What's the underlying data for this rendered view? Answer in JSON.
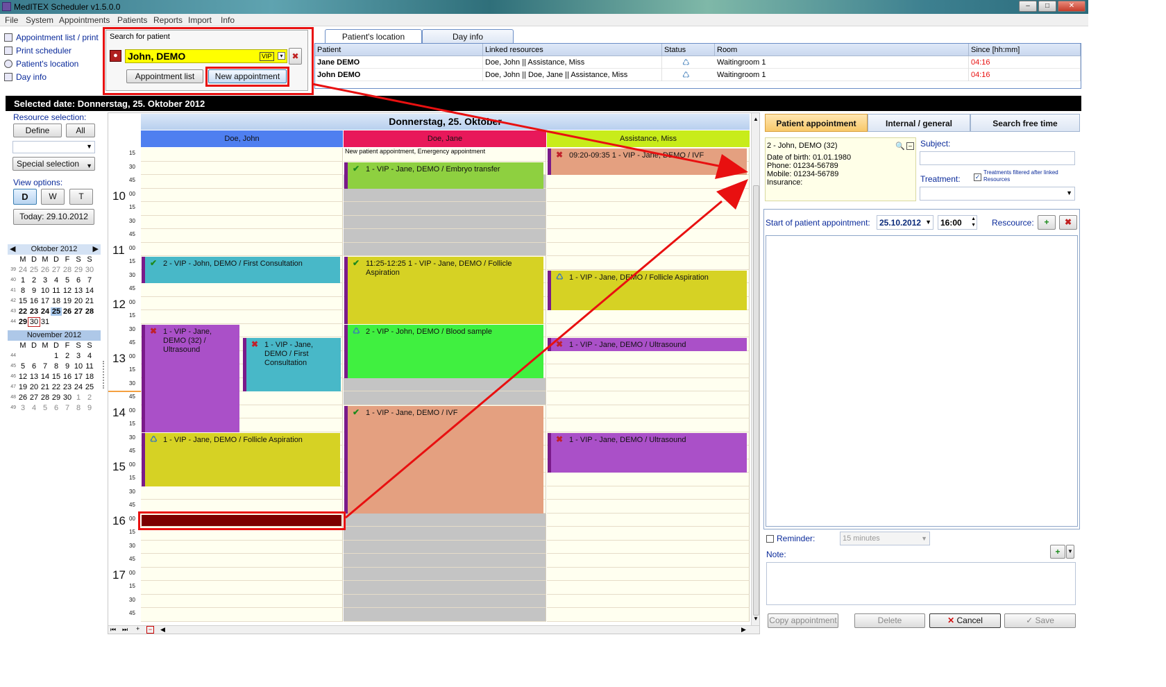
{
  "window": {
    "title": "MedITEX  Scheduler v1.5.0.0"
  },
  "menu": [
    "File",
    "System",
    "Appointments",
    "Patients",
    "Reports",
    "Import",
    "Info"
  ],
  "left_links": [
    "Appointment list / print",
    "Print scheduler",
    "Patient's location",
    "Day info"
  ],
  "search": {
    "label": "Search for patient",
    "patient_name": "John, DEMO",
    "vip_badge": "VIP",
    "appointment_list_btn": "Appointment list",
    "new_appointment_btn": "New appointment"
  },
  "location": {
    "tabs": [
      "Patient's location",
      "Day info"
    ],
    "columns": [
      "Patient",
      "Linked resources",
      "Status",
      "Room",
      "Since [hh:mm]"
    ],
    "rows": [
      {
        "patient": "Jane DEMO",
        "resources": "Doe, John || Assistance, Miss",
        "room": "Waitingroom 1",
        "since": "04:16"
      },
      {
        "patient": "John DEMO",
        "resources": "Doe, John || Doe, Jane || Assistance, Miss",
        "room": "Waitingroom 1",
        "since": "04:16"
      }
    ]
  },
  "selected_date_bar": "Selected date: Donnerstag, 25. Oktober 2012",
  "left_panel": {
    "resource_selection": "Resource selection:",
    "define_btn": "Define",
    "all_btn": "All",
    "special_selection": "Special selection",
    "view_options": "View options:",
    "view_d": "D",
    "view_w": "W",
    "view_t": "T",
    "today_btn": "Today: 29.10.2012"
  },
  "calendar": {
    "october": {
      "title": "Oktober 2012",
      "weekdays": [
        "M",
        "D",
        "M",
        "D",
        "F",
        "S",
        "S"
      ],
      "rows": [
        {
          "wk": "39",
          "days": [
            "24",
            "25",
            "26",
            "27",
            "28",
            "29",
            "30"
          ]
        },
        {
          "wk": "40",
          "days": [
            "1",
            "2",
            "3",
            "4",
            "5",
            "6",
            "7"
          ]
        },
        {
          "wk": "41",
          "days": [
            "8",
            "9",
            "10",
            "11",
            "12",
            "13",
            "14"
          ]
        },
        {
          "wk": "42",
          "days": [
            "15",
            "16",
            "17",
            "18",
            "19",
            "20",
            "21"
          ]
        },
        {
          "wk": "43",
          "days": [
            "22",
            "23",
            "24",
            "25",
            "26",
            "27",
            "28"
          ]
        },
        {
          "wk": "44",
          "days": [
            "29",
            "30",
            "31",
            "",
            "",
            "",
            ""
          ]
        }
      ]
    },
    "november": {
      "title": "November 2012",
      "weekdays": [
        "M",
        "D",
        "M",
        "D",
        "F",
        "S",
        "S"
      ],
      "rows": [
        {
          "wk": "44",
          "days": [
            "",
            "",
            "",
            "1",
            "2",
            "3",
            "4"
          ]
        },
        {
          "wk": "45",
          "days": [
            "5",
            "6",
            "7",
            "8",
            "9",
            "10",
            "11"
          ]
        },
        {
          "wk": "46",
          "days": [
            "12",
            "13",
            "14",
            "15",
            "16",
            "17",
            "18"
          ]
        },
        {
          "wk": "47",
          "days": [
            "19",
            "20",
            "21",
            "22",
            "23",
            "24",
            "25"
          ]
        },
        {
          "wk": "48",
          "days": [
            "26",
            "27",
            "28",
            "29",
            "30",
            "1",
            "2"
          ]
        },
        {
          "wk": "49",
          "days": [
            "3",
            "4",
            "5",
            "6",
            "7",
            "8",
            "9"
          ]
        }
      ]
    }
  },
  "scheduler": {
    "day_title": "Donnerstag, 25. Oktober",
    "resources": [
      {
        "name": "Doe, John",
        "color": "#4f7ff0"
      },
      {
        "name": "Doe, Jane",
        "color": "#e8185a"
      },
      {
        "name": "Assistance, Miss",
        "color": "#c8ec1a"
      }
    ],
    "hour_labels": [
      "10",
      "11",
      "12",
      "13",
      "14",
      "15",
      "16",
      "17"
    ],
    "minute_labels": [
      "00",
      "15",
      "30",
      "45"
    ],
    "jane_header_note": "New patient appointment, Emergency appointment",
    "appointments": [
      {
        "res": 1,
        "text": "1 - VIP - Jane, DEMO / Embryo transfer",
        "marker": "check",
        "color": "#8ed040"
      },
      {
        "res": 2,
        "text": "09:20-09:35 1 - VIP - Jane, DEMO / IVF",
        "marker": "cross",
        "color": "#e4a080"
      },
      {
        "res": 0,
        "text": "2 - VIP - John, DEMO / First Consultation",
        "marker": "check",
        "color": "#48b8c8"
      },
      {
        "res": 1,
        "text": "11:25-12:25 1 - VIP - Jane, DEMO / Follicle Aspiration",
        "marker": "check",
        "color": "#d6d224"
      },
      {
        "res": 2,
        "text": "1 - VIP - Jane, DEMO / Follicle Aspiration",
        "marker": "seat",
        "color": "#d6d224"
      },
      {
        "res": 0,
        "text": "1 - VIP - Jane, DEMO (32) / Ultrasound",
        "marker": "cross",
        "color": "#aa50c8"
      },
      {
        "res": 0,
        "text": "1 - VIP - Jane, DEMO / First Consultation",
        "marker": "cross",
        "color": "#48b8c8"
      },
      {
        "res": 1,
        "text": "2 - VIP - John, DEMO / Blood sample",
        "marker": "seat",
        "color": "#40f040"
      },
      {
        "res": 2,
        "text": "1 - VIP - Jane, DEMO / Ultrasound",
        "marker": "cross",
        "color": "#aa50c8"
      },
      {
        "res": 1,
        "text": "1 - VIP - Jane, DEMO / IVF",
        "marker": "check",
        "color": "#e4a080"
      },
      {
        "res": 0,
        "text": "1 - VIP - Jane, DEMO / Follicle Aspiration",
        "marker": "seat",
        "color": "#d6d224"
      },
      {
        "res": 2,
        "text": "1 - VIP - Jane, DEMO / Ultrasound",
        "marker": "cross",
        "color": "#aa50c8"
      }
    ]
  },
  "right_panel": {
    "tabs": [
      "Patient appointment",
      "Internal / general",
      "Search free time"
    ],
    "patient_line": "2 - John, DEMO (32)",
    "dob": "Date of birth: 01.01.1980",
    "phone": "Phone: 01234-56789",
    "mobile": "Mobile: 01234-56789",
    "insurance": "Insurance:",
    "subject_label": "Subject:",
    "treatment_label": "Treatment:",
    "treat_filter_note": "Treatments filtered after linked Resources",
    "start_label": "Start of patient appointment:",
    "start_date": "25.10.2012",
    "start_time": "16:00",
    "resource_label": "Rescource:",
    "reminder_label": "Reminder:",
    "reminder_value": "15 minutes",
    "note_label": "Note:",
    "copy_btn": "Copy appointment",
    "delete_btn": "Delete",
    "cancel_btn": "Cancel",
    "save_btn": "Save"
  },
  "colors": {
    "highlight_red": "#e81010",
    "patient_yellow": "#ffff00",
    "blocked_gray": "#c4c4c4",
    "cell_cream": "#fffff0",
    "new_slot": "#7c0000"
  }
}
